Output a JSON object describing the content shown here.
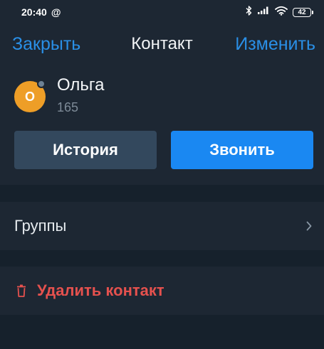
{
  "status_bar": {
    "time": "20:40",
    "at_symbol": "@",
    "battery": "42",
    "icons": [
      "bluetooth-icon",
      "signal-icon",
      "wifi-icon",
      "battery-icon"
    ]
  },
  "nav": {
    "close_label": "Закрыть",
    "title": "Контакт",
    "edit_label": "Изменить"
  },
  "contact": {
    "avatar_initial": "О",
    "name": "Ольга",
    "number": "165",
    "avatar_color": "#ee9e27"
  },
  "actions": {
    "history_label": "История",
    "call_label": "Звонить"
  },
  "rows": {
    "groups_label": "Группы",
    "delete_label": "Удалить контакт"
  },
  "colors": {
    "background": "#16212c",
    "panel": "#1d2733",
    "accent": "#1a88f2",
    "link": "#2a8fe6",
    "danger": "#e5514e",
    "secondary_button": "#33485d"
  }
}
